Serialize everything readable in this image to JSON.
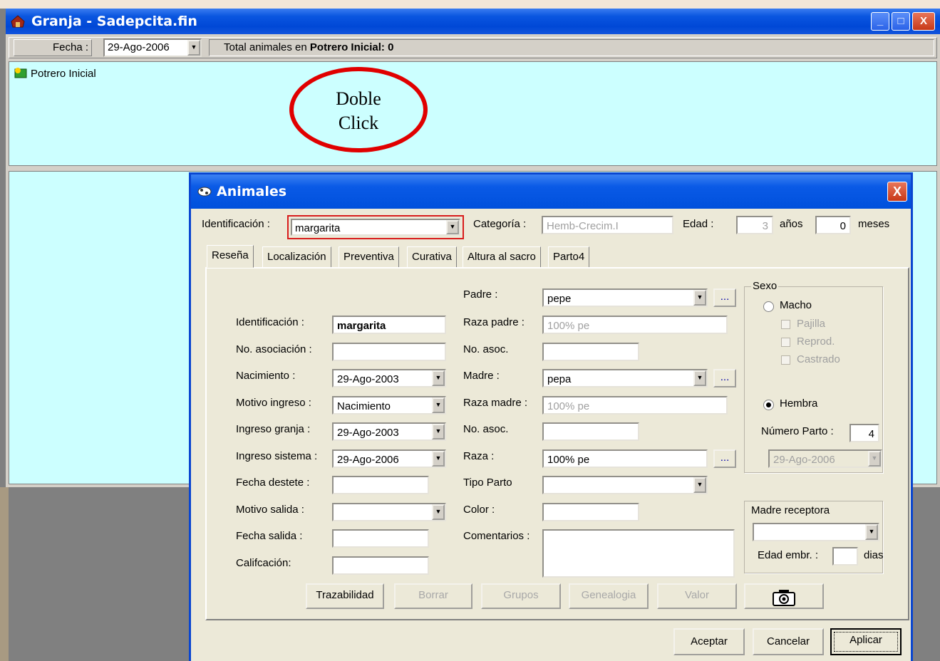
{
  "main_window": {
    "title": "Granja - Sadepcita.fin",
    "fecha_label": "Fecha :",
    "fecha_value": "29-Ago-2006",
    "total_prefix": "Total animales en ",
    "total_bold": "Potrero Inicial: 0",
    "tree_item": "Potrero Inicial",
    "min_glyph": "_",
    "max_glyph": "□",
    "close_glyph": "X"
  },
  "annotation": {
    "line1": "Doble",
    "line2": "Click",
    "color": "#e00000"
  },
  "dialog": {
    "title": "Animales",
    "close_glyph": "X",
    "top": {
      "id_label": "Identificación :",
      "id_value": "margarita",
      "categoria_label": "Categoría :",
      "categoria_value": "Hemb-Crecim.I",
      "edad_label": "Edad :",
      "edad_anos": "3",
      "anos_label": "años",
      "edad_meses": "0",
      "meses_label": "meses"
    },
    "tabs": [
      "Reseña",
      "Localización",
      "Preventiva",
      "Curativa",
      "Altura al sacro",
      "Parto4"
    ],
    "left": {
      "identificacion_label": "Identificación :",
      "identificacion_value": "margarita",
      "asociacion_label": "No. asociación :",
      "asociacion_value": "",
      "nacimiento_label": "Nacimiento :",
      "nacimiento_value": "29-Ago-2003",
      "motivo_ingreso_label": "Motivo ingreso :",
      "motivo_ingreso_value": "Nacimiento",
      "ingreso_granja_label": "Ingreso granja :",
      "ingreso_granja_value": "29-Ago-2003",
      "ingreso_sistema_label": "Ingreso sistema :",
      "ingreso_sistema_value": "29-Ago-2006",
      "destete_label": "Fecha destete :",
      "destete_value": "",
      "motivo_salida_label": "Motivo salida :",
      "motivo_salida_value": "",
      "fecha_salida_label": "Fecha salida :",
      "fecha_salida_value": "",
      "calificacion_label": "Califcación:",
      "calificacion_value": ""
    },
    "middle": {
      "padre_label": "Padre :",
      "padre_value": "pepe",
      "raza_padre_label": "Raza padre :",
      "raza_padre_value": "100% pe",
      "asoc1_label": "No. asoc.",
      "asoc1_value": "",
      "madre_label": "Madre :",
      "madre_value": "pepa",
      "raza_madre_label": "Raza madre :",
      "raza_madre_value": "100% pe",
      "asoc2_label": "No. asoc.",
      "asoc2_value": "",
      "raza_label": "Raza :",
      "raza_value": "100% pe",
      "tipo_parto_label": "Tipo Parto",
      "tipo_parto_value": "",
      "color_label": "Color :",
      "color_value": "",
      "comentarios_label": "Comentarios :",
      "comentarios_value": "",
      "ellipsis": "..."
    },
    "sexo": {
      "legend": "Sexo",
      "macho": "Macho",
      "pajilla": "Pajilla",
      "reprod": "Reprod.",
      "castrado": "Castrado",
      "hembra": "Hembra",
      "hembra_selected": true,
      "numero_parto_label": "Número Parto :",
      "numero_parto_value": "4",
      "parto_date": "29-Ago-2006"
    },
    "receptora": {
      "legend": "Madre receptora",
      "value": "",
      "edad_embr_label": "Edad embr. :",
      "edad_embr_value": "",
      "dias_label": "dias"
    },
    "buttons": {
      "trazabilidad": "Trazabilidad",
      "borrar": "Borrar",
      "grupos": "Grupos",
      "genealogia": "Genealogia",
      "valor": "Valor",
      "aceptar": "Aceptar",
      "cancelar": "Cancelar",
      "aplicar": "Aplicar"
    }
  }
}
